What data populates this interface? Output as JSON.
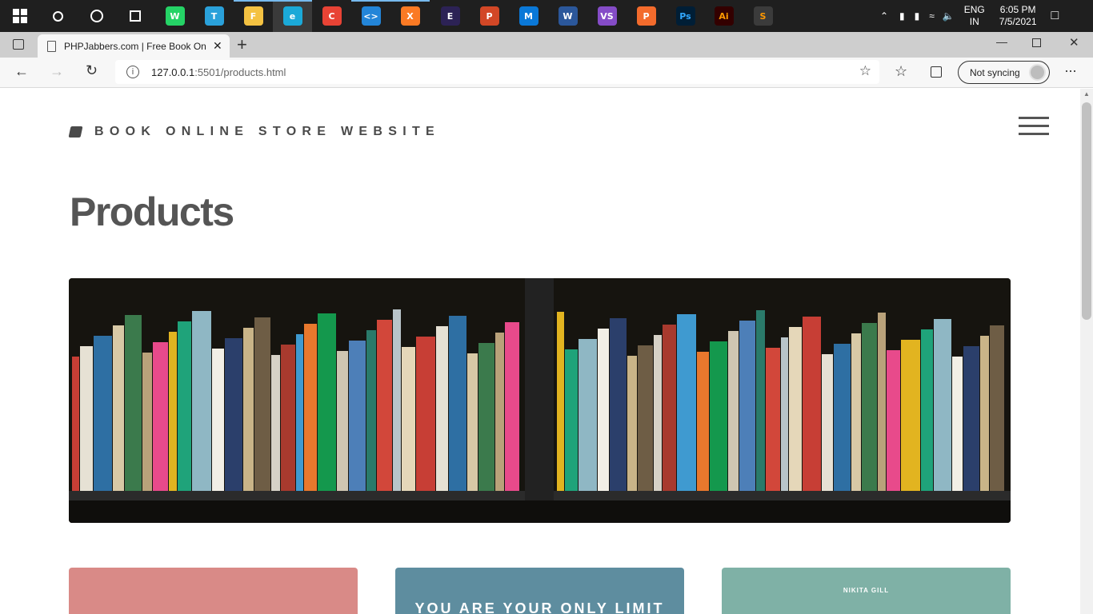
{
  "taskbar": {
    "apps": [
      {
        "name": "start",
        "letter": ""
      },
      {
        "name": "search",
        "letter": ""
      },
      {
        "name": "cortana",
        "letter": ""
      },
      {
        "name": "task-view",
        "letter": ""
      },
      {
        "name": "whatsapp",
        "letter": "W",
        "color": "#25d366"
      },
      {
        "name": "telegram",
        "letter": "T",
        "color": "#2aa1da"
      },
      {
        "name": "file-explorer",
        "letter": "F",
        "color": "#f4c242"
      },
      {
        "name": "edge",
        "letter": "e",
        "color": "#1ba9d8"
      },
      {
        "name": "chrome",
        "letter": "C",
        "color": "#e84335"
      },
      {
        "name": "vscode",
        "letter": "<>",
        "color": "#2385d8"
      },
      {
        "name": "xampp",
        "letter": "X",
        "color": "#fb7a24"
      },
      {
        "name": "eclipse",
        "letter": "E",
        "color": "#2c2255"
      },
      {
        "name": "powerpoint",
        "letter": "P",
        "color": "#d24726"
      },
      {
        "name": "mail",
        "letter": "M",
        "color": "#0a78d7"
      },
      {
        "name": "word",
        "letter": "W",
        "color": "#2b579a"
      },
      {
        "name": "visual-studio",
        "letter": "VS",
        "color": "#854cc7"
      },
      {
        "name": "postman",
        "letter": "P",
        "color": "#f36b2c"
      },
      {
        "name": "photoshop",
        "letter": "Ps",
        "color": "#001e36",
        "text_color": "#31a8ff"
      },
      {
        "name": "illustrator",
        "letter": "Ai",
        "color": "#330000",
        "text_color": "#ff9a00"
      },
      {
        "name": "sublime",
        "letter": "S",
        "color": "#3b3b3b",
        "text_color": "#ff9800"
      }
    ],
    "language_line1": "ENG",
    "language_line2": "IN",
    "time": "6:05 PM",
    "date": "7/5/2021"
  },
  "browser": {
    "tab_title": "PHPJabbers.com | Free Book Onli",
    "url_host": "127.0.0.1",
    "url_rest": ":5501/products.html",
    "sync_label": "Not syncing"
  },
  "site": {
    "brand": "BOOK ONLINE STORE WEBSITE",
    "page_title": "Products",
    "cards": [
      {
        "text": "",
        "color": "#d98a87"
      },
      {
        "text": "YOU ARE YOUR ONLY LIMIT",
        "color": "#5e8d9f"
      },
      {
        "text": "NIKITA GILL",
        "color": "#7fb1a6"
      }
    ]
  },
  "colors": {
    "taskbar_bg": "#1f1f1f",
    "tab_strip_bg": "#cecece",
    "text_dark": "#555555"
  }
}
